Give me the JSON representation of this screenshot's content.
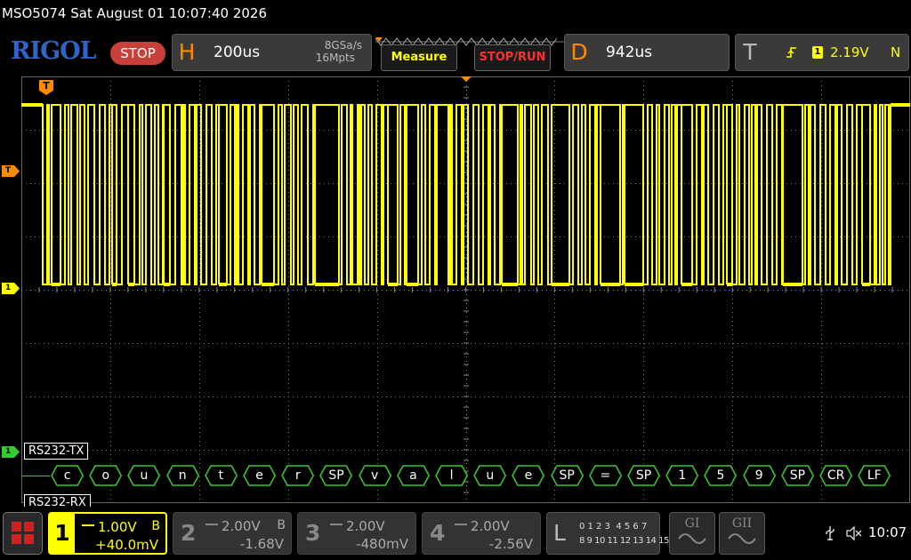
{
  "status": {
    "text": "MSO5074  Sat August 01 10:07:40 2026"
  },
  "toolbar": {
    "logo": "RIGOL",
    "run_state": "STOP",
    "horizontal": {
      "letter": "H",
      "timebase": "200us",
      "sample_rate": "8GSa/s",
      "memory_depth": "16Mpts"
    },
    "measure_label": "Measure",
    "stop_run_label": "STOP/RUN",
    "delay": {
      "letter": "D",
      "value": "942us"
    },
    "trigger": {
      "letter": "T",
      "source": "1",
      "level": "2.19V",
      "mode": "N"
    }
  },
  "markers": {
    "trigger_pos": "T",
    "trigger_level": "T",
    "ch1_ref": "1",
    "bus_ref": "1"
  },
  "decode": {
    "bus1_label": "RS232-TX",
    "bus2_label": "RS232-RX",
    "symbols": [
      "c",
      "o",
      "u",
      "n",
      "t",
      "e",
      "r",
      "SP",
      "v",
      "a",
      "l",
      "u",
      "e",
      "SP",
      "=",
      "SP",
      "1",
      "5",
      "9",
      "SP",
      "CR",
      "LF"
    ]
  },
  "waveform": {
    "color": "#ffff00",
    "pulse_groups": [
      [
        24,
        34
      ],
      [
        44,
        102
      ],
      [
        107,
        120
      ],
      [
        127,
        160
      ],
      [
        167,
        222
      ],
      [
        231,
        270
      ],
      [
        284,
        330
      ],
      [
        357,
        360
      ],
      [
        366,
        412
      ],
      [
        423,
        433
      ],
      [
        446,
        472
      ],
      [
        480,
        540
      ],
      [
        558,
        596
      ],
      [
        616,
        651
      ],
      [
        673,
        678
      ],
      [
        699,
        742
      ],
      [
        754,
        793
      ],
      [
        799,
        856
      ],
      [
        878,
        945
      ],
      [
        954,
        977
      ]
    ]
  },
  "channels": [
    {
      "num": "1",
      "volts": "1.00V",
      "bw": "B",
      "offset": "+40.0mV",
      "active": true,
      "color": "#ffff00"
    },
    {
      "num": "2",
      "volts": "2.00V",
      "bw": "B",
      "offset": "-1.68V",
      "active": false,
      "color": "#888888"
    },
    {
      "num": "3",
      "volts": "2.00V",
      "bw": "",
      "offset": "-480mV",
      "active": false,
      "color": "#888888"
    },
    {
      "num": "4",
      "volts": "2.00V",
      "bw": "",
      "offset": "-2.56V",
      "active": false,
      "color": "#888888"
    }
  ],
  "logic": {
    "letter": "L",
    "row1": "0 1 2 3  4 5 6 7",
    "row2": "8 9 10 11 12 13 14 15"
  },
  "generators": {
    "g1": "GI",
    "g2": "GII"
  },
  "system": {
    "time": "10:07",
    "usb_icon": "usb-icon",
    "sound_icon": "speaker-muted-icon"
  },
  "colors": {
    "ch1": "#ffff00",
    "bus": "#33cc33",
    "trigger": "#ff8a00",
    "brand": "#2f64c8",
    "stop": "#c8403a",
    "stop_run_text": "#ff3030"
  }
}
